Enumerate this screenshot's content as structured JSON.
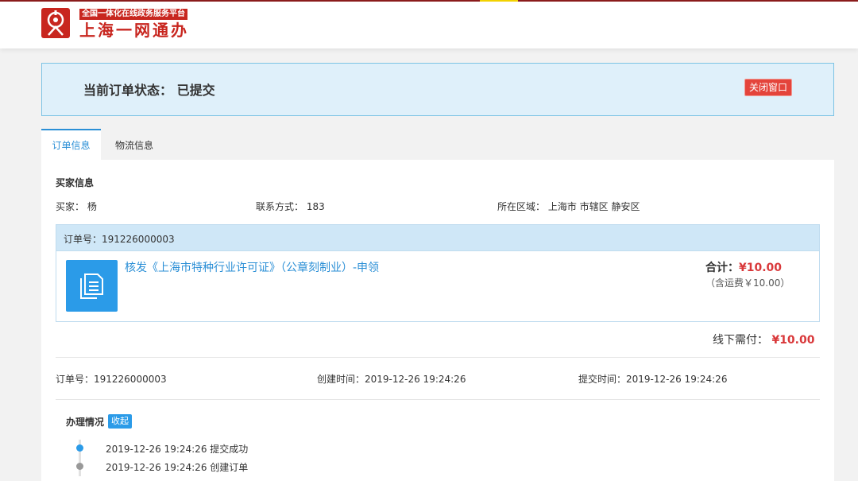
{
  "header": {
    "platform_tag": "全国一体化在线政务服务平台",
    "title": "上海一网通办"
  },
  "status": {
    "label": "当前订单状态： 已提交",
    "close_label": "关闭窗口"
  },
  "tabs": [
    {
      "label": "订单信息",
      "active": true
    },
    {
      "label": "物流信息",
      "active": false
    }
  ],
  "buyer": {
    "section_title": "买家信息",
    "name": "买家： 杨",
    "contact": "联系方式： 183",
    "region": "所在区域： 上海市  市辖区  静安区"
  },
  "order": {
    "number_bar": "订单号：191226000003",
    "item_name": "核发《上海市特种行业许可证》（公章刻制业）-申领",
    "total_label": "合计：",
    "total_amount": "¥10.00",
    "shipping": "（含运费￥10.00）",
    "offline_label": "线下需付：",
    "offline_amount": "¥10.00"
  },
  "meta": {
    "order_no": "订单号：191226000003",
    "created": "创建时间：2019-12-26 19:24:26",
    "submitted": "提交时间：2019-12-26 19:24:26"
  },
  "progress": {
    "title": "办理情况",
    "toggle_label": "收起",
    "entries": [
      {
        "text": "2019-12-26 19:24:26   提交成功",
        "color": "#2b9be8"
      },
      {
        "text": "2019-12-26 19:24:26   创建订单",
        "color": "#999999"
      }
    ]
  },
  "colors": {
    "brand_red": "#c8261f",
    "accent_blue": "#2b8fd6",
    "price_red": "#d9383a"
  },
  "icons": [
    "shanghai-logo-icon",
    "document-icon"
  ]
}
